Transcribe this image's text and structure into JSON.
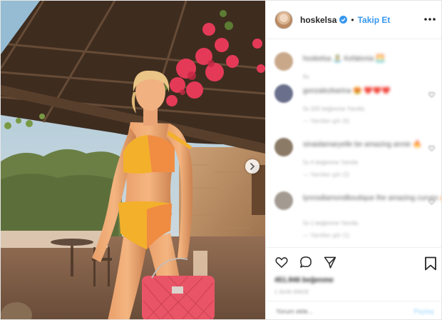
{
  "post": {
    "image_description": "Woman in an orange and yellow two-piece swimsuit holding a pink quilted handbag under a pergola with pink bougainvillea at sunset",
    "carousel_next_icon": "chevron-right-icon"
  },
  "header": {
    "username": "hoskelsa",
    "verified_icon": "verified-badge-icon",
    "separator": "•",
    "follow_label": "Takip Et",
    "more_icon": "more-horizontal-icon"
  },
  "comments": [
    {
      "text": "hoskelsa 🏝️ Kefalonia 🌅",
      "meta": "6s",
      "reply": "",
      "avatar_color": "#c9a88a"
    },
    {
      "text": "gonzalezkarina 😍 ❤️❤️❤️",
      "meta": "5s   325 beğenme   Yanıtla",
      "reply": "—   Yanıtları gör (6)",
      "avatar_color": "#6a6f8c"
    },
    {
      "text": "sinaidamaryelle be amazing annie 🔥",
      "meta": "5s   4 beğenme   Yanıtla",
      "reply": "—   Yanıtları gör (2)",
      "avatar_color": "#8a7a66"
    },
    {
      "text": "lynnsdiamondboutique the amazing curves 🔥",
      "meta": "5s   1 beğenme   Yanıtla",
      "reply": "—   Yanıtları gör (1)",
      "avatar_color": "#a39a92"
    }
  ],
  "actions": {
    "like_icon": "heart-icon",
    "comment_icon": "comment-icon",
    "share_icon": "share-icon",
    "save_icon": "bookmark-icon",
    "likes_text": "451.846 beğenme",
    "date_text": "1 GÜN ÖNCE"
  },
  "add_comment": {
    "placeholder": "Yorum ekle...",
    "post_label": "Paylaş"
  },
  "colors": {
    "accent": "#3897f0",
    "text": "#262626",
    "muted": "#999999",
    "border": "#efefef"
  }
}
